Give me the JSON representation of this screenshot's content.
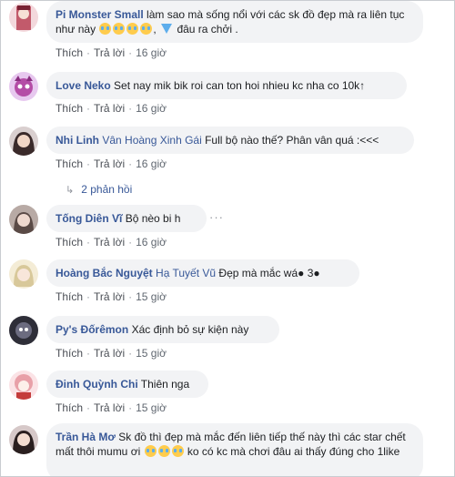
{
  "comments": [
    {
      "name": "Pi Monster Small",
      "text_1": "làm sao mà sống nổi với các sk đồ đẹp mà ra liên tục như này",
      "text_2": ",",
      "text_3": "đâu ra chởi .",
      "like": "Thích",
      "reply": "Trả lời",
      "time": "16 giờ",
      "avatar_color": "#c25a6b"
    },
    {
      "name": "Love Neko",
      "text": "Set nay mik bik roi can ton hoi nhieu kc nha co 10k↑",
      "like": "Thích",
      "reply": "Trả lời",
      "time": "16 giờ",
      "avatar_color": "#b44ca6"
    },
    {
      "name": "Nhi Linh",
      "tag": "Vân Hoàng Xinh Gái",
      "text": "Full bộ nào thế? Phân vân quá :<<<",
      "like": "Thích",
      "reply": "Trả lời",
      "time": "16 giờ",
      "replies_label": "2 phản hồi",
      "avatar_color": "#6b4f4f"
    },
    {
      "name": "Tống Diên Vĩ",
      "text": "Bộ nèo bi h",
      "more": "···",
      "like": "Thích",
      "reply": "Trả lời",
      "time": "16 giờ",
      "avatar_color": "#8c7b74"
    },
    {
      "name": "Hoàng Bắc Nguyệt",
      "tag": "Hạ Tuyết Vũ",
      "text": "Đẹp mà mắc wá● 3●",
      "like": "Thích",
      "reply": "Trả lời",
      "time": "15 giờ",
      "avatar_color": "#d8c89a"
    },
    {
      "name": "Py's Đốrêmon",
      "text": "Xác định bỏ sự kiện này",
      "like": "Thích",
      "reply": "Trả lời",
      "time": "15 giờ",
      "avatar_color": "#3d3d4a"
    },
    {
      "name": "Đinh Quỳnh Chi",
      "text": "Thiên nga",
      "like": "Thích",
      "reply": "Trả lời",
      "time": "15 giờ",
      "avatar_color": "#e8a0a8"
    },
    {
      "name": "Trần Hà Mơ",
      "text_1": "Sk đồ thì đẹp mà mắc đến liên tiếp thế này thì các star chết mất thôi mumu ơi",
      "text_2": "ko có kc mà chơi đâu ai thấy đúng cho 1like",
      "avatar_color": "#4a3a3a"
    }
  ],
  "colors": {
    "name": "#385898",
    "bubble": "#f2f3f5",
    "meta": "#606770"
  }
}
